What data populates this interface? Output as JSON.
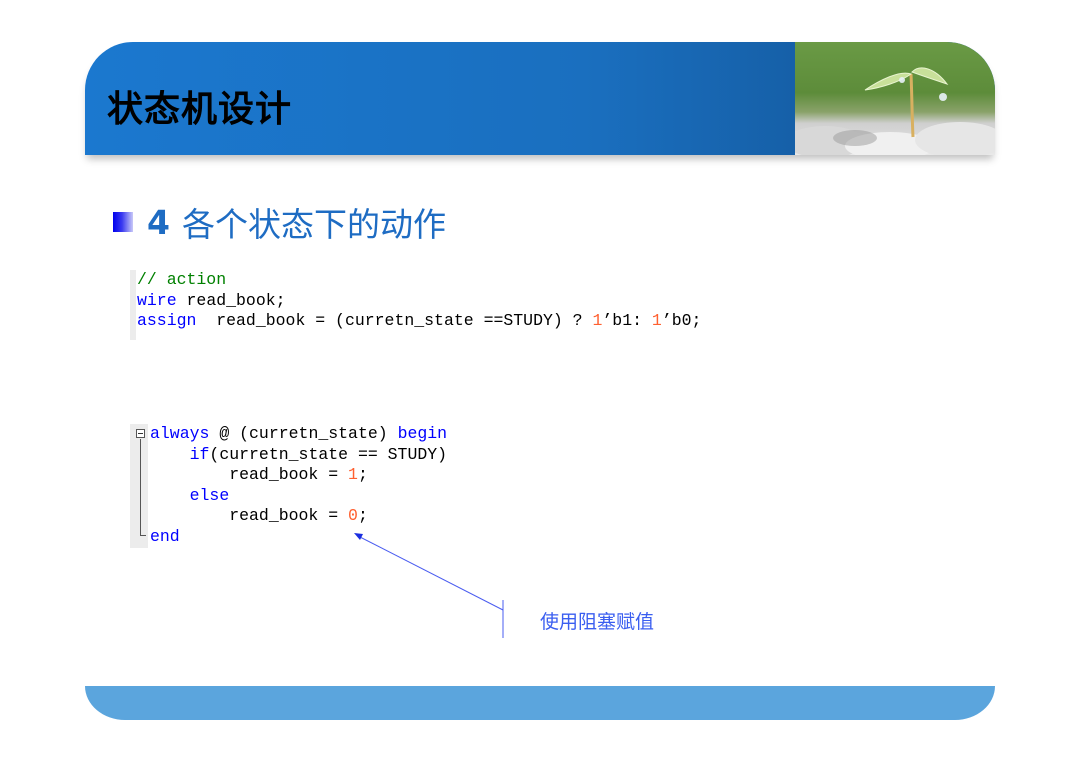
{
  "slide": {
    "title": "状态机设计",
    "section": {
      "number": "4",
      "heading": "各个状态下的动作"
    },
    "code_block_1": {
      "lines": [
        {
          "comment": "// action"
        },
        {
          "kw": "wire",
          "rest": " read_book;"
        },
        {
          "kw": "assign",
          "rest_a": "  read_book = (curretn_state ==STUDY) ? ",
          "n1": "1",
          "rest_b": "’b1: ",
          "n2": "1",
          "rest_c": "’b0;"
        }
      ]
    },
    "code_block_2": {
      "line1_kw1": "always",
      "line1_mid": " @ (curretn_state) ",
      "line1_kw2": "begin",
      "line2_indent": "    ",
      "line2_kw": "if",
      "line2_rest": "(curretn_state == STUDY)",
      "line3_code": "        read_book = ",
      "line3_num": "1",
      "line3_end": ";",
      "line4_indent": "    ",
      "line4_kw": "else",
      "line5_code": "        read_book = ",
      "line5_num": "0",
      "line5_end": ";",
      "line6_kw": "end"
    },
    "annotation": {
      "text": "使用阻塞赋值"
    },
    "colors": {
      "header_blue": "#1b78cf",
      "title_blue": "#1e6cc3",
      "footer_blue": "#5ba5dd",
      "keyword_blue": "#0000ff",
      "comment_green": "#008000",
      "number_orange": "#ff6030",
      "annotation_blue": "#3a5ef0"
    }
  }
}
